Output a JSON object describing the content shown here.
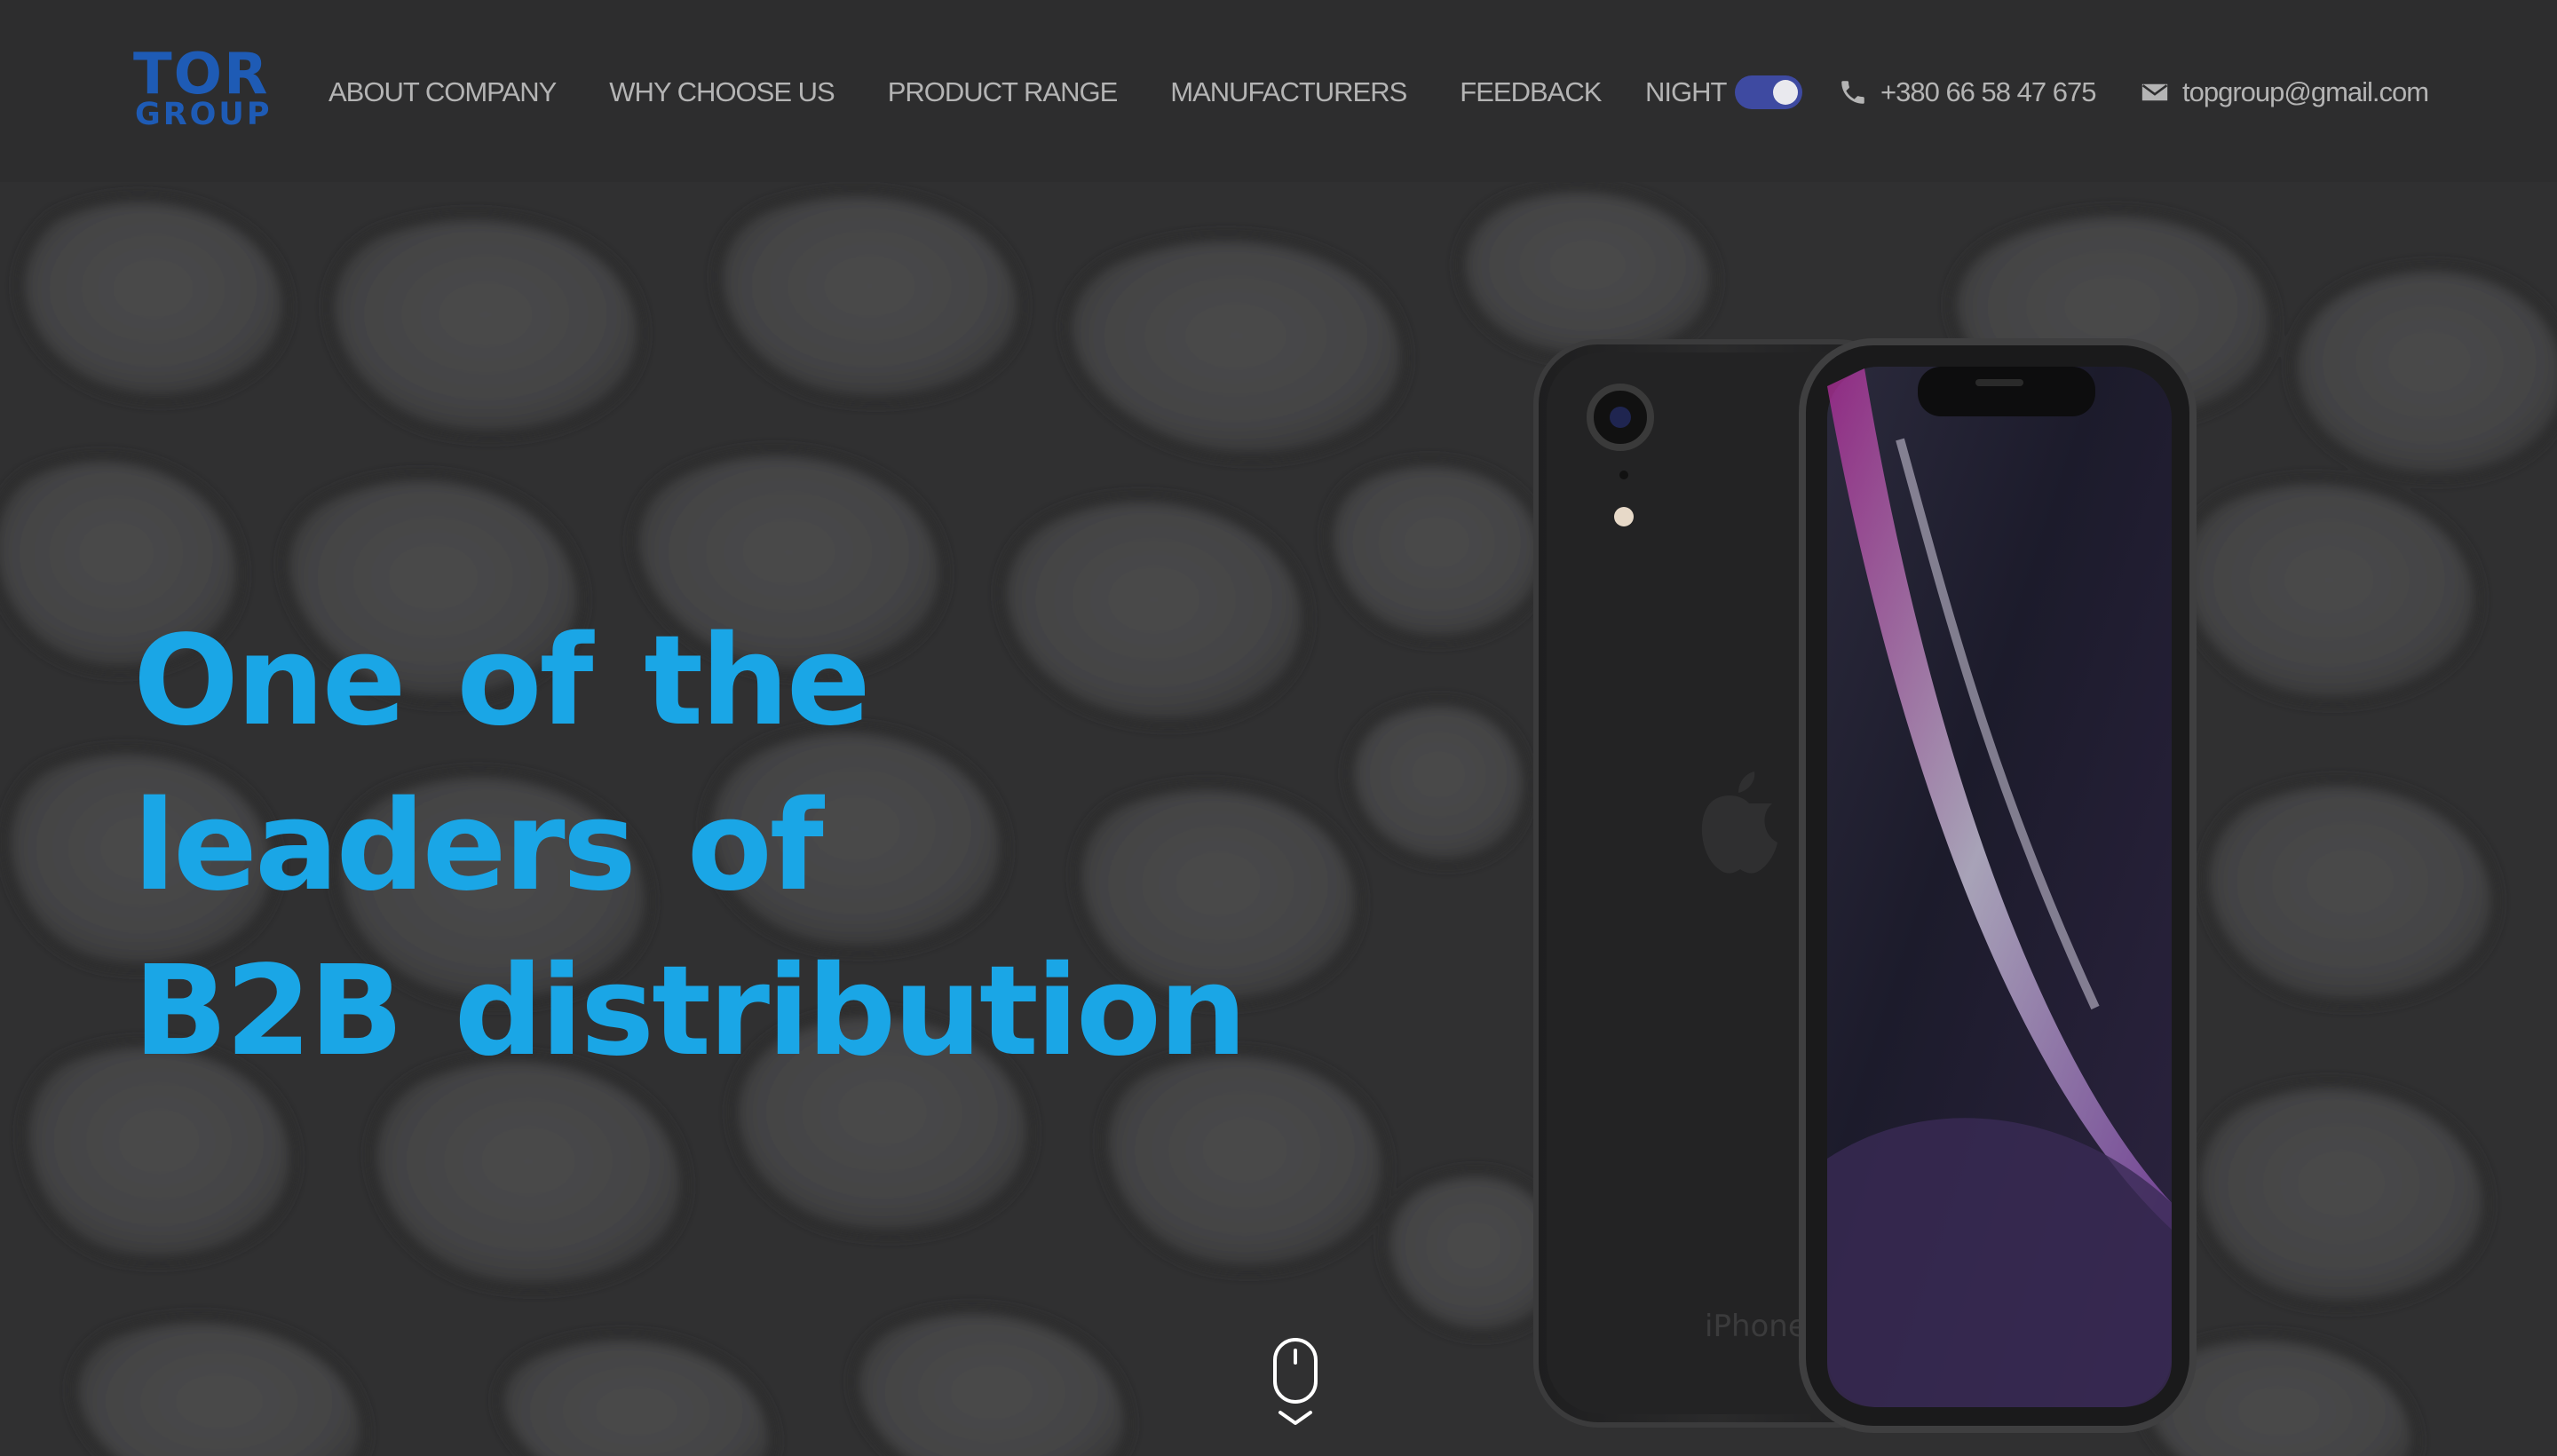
{
  "brand": {
    "logo_top": "TOR",
    "logo_bottom": "GROUP",
    "color": "#1e5bb5"
  },
  "nav": {
    "items": [
      {
        "label": "ABOUT COMPANY"
      },
      {
        "label": "WHY CHOOSE US"
      },
      {
        "label": "PRODUCT RANGE"
      },
      {
        "label": "MANUFACTURERS"
      },
      {
        "label": "FEEDBACK"
      }
    ]
  },
  "theme_toggle": {
    "label": "NIGHT",
    "state": "on",
    "color": "#3e4aa1"
  },
  "contacts": {
    "phone": "+380 66 58 47 675",
    "phone_icon": "phone-icon",
    "email": "topgroup@gmail.com",
    "email_icon": "envelope-icon"
  },
  "hero": {
    "headline_lines": [
      "One of the",
      "leaders of",
      "B2B distribution"
    ],
    "headline_color": "#1aa6e6",
    "product_image": "smartphone-front-back-photo",
    "phone_branding": "iPhone",
    "scroll_icon": "mouse-scroll-icon"
  },
  "colors": {
    "header_bg": "#2d2d2e",
    "hero_bg": "#3b3b3c",
    "nav_text": "#b4b4b4"
  }
}
